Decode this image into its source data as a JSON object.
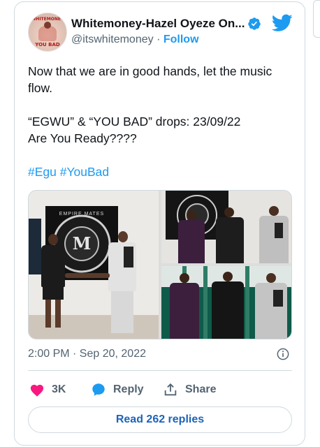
{
  "author": {
    "display_name": "Whitemoney-Hazel Oyeze On...",
    "handle": "@itswhitemoney",
    "separator": "·",
    "follow_label": "Follow",
    "avatar_top_text": "WHITEMONEY",
    "avatar_bottom_text": "YOU BAD"
  },
  "tweet": {
    "lines": [
      "Now that we are in good hands, let the music",
      "flow.",
      "“EGWU” & “YOU BAD” drops: 23/09/22",
      "Are You Ready????"
    ],
    "hashtags": [
      "#Egu",
      "#YouBad"
    ]
  },
  "media": {
    "wall_sign_text": "EMPIRE MATES"
  },
  "meta": {
    "timestamp": "2:00 PM · Sep 20, 2022"
  },
  "actions": {
    "likes_count": "3K",
    "reply_label": "Reply",
    "share_label": "Share"
  },
  "replies_button": "Read 262 replies",
  "colors": {
    "accent": "#1d9bf0",
    "like": "#f91880",
    "text": "#0f1419",
    "muted": "#536471",
    "border": "#cfd9de"
  }
}
